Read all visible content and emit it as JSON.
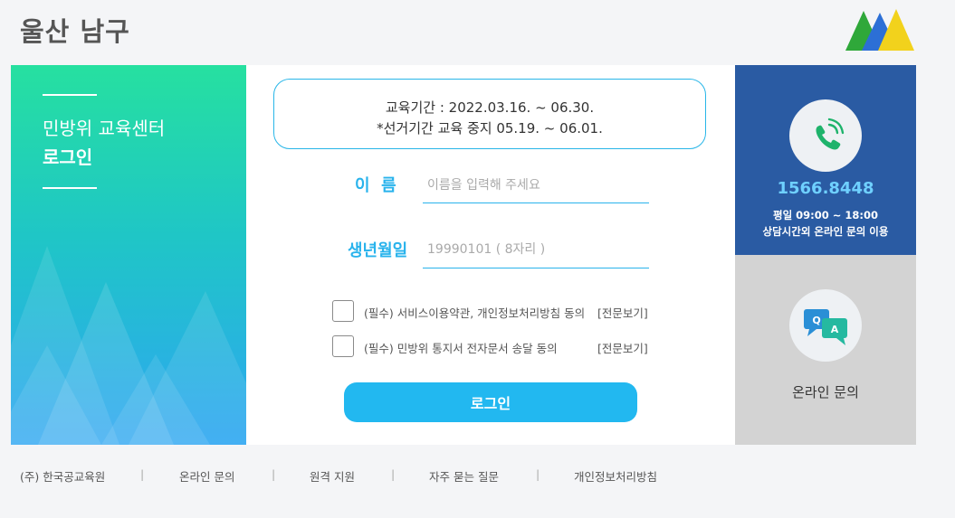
{
  "header": {
    "title": "울산 남구"
  },
  "left_panel": {
    "subtitle": "민방위 교육센터",
    "title": "로그인"
  },
  "notice": {
    "line1": "교육기간 : 2022.03.16. ~ 06.30.",
    "line2": "*선거기간 교육 중지 05.19. ~ 06.01."
  },
  "form": {
    "name_label": "이  름",
    "name_placeholder": "이름을 입력해 주세요",
    "name_value": "",
    "birth_label": "생년월일",
    "birth_placeholder": "19990101 ( 8자리 )",
    "birth_value": ""
  },
  "agreements": [
    {
      "text": "(필수) 서비스이용약관, 개인정보처리방침 동의",
      "link": "[전문보기]",
      "checked": false
    },
    {
      "text": "(필수) 민방위 통지서 전자문서 송달 동의",
      "link": "[전문보기]",
      "checked": false
    }
  ],
  "login_button": "로그인",
  "contact": {
    "icon": "phone-icon",
    "number": "1566.8448",
    "hours": "평일 09:00 ~ 18:00",
    "note": "상담시간외 온라인 문의 이용"
  },
  "online_inquiry": {
    "icon": "qa-chat-icon",
    "label": "온라인 문의"
  },
  "footer": {
    "links": [
      "(주) 한국공교육원",
      "온라인 문의",
      "원격 지원",
      "자주 묻는 질문",
      "개인정보처리방침"
    ],
    "separator": "|"
  },
  "colors": {
    "accent": "#29b3ec",
    "button": "#22b8f0",
    "contact_bg": "#2a5ba3",
    "qa_bg": "#d3d3d3",
    "gradient_top": "#26e0a0",
    "gradient_bottom": "#2ea6f2"
  }
}
